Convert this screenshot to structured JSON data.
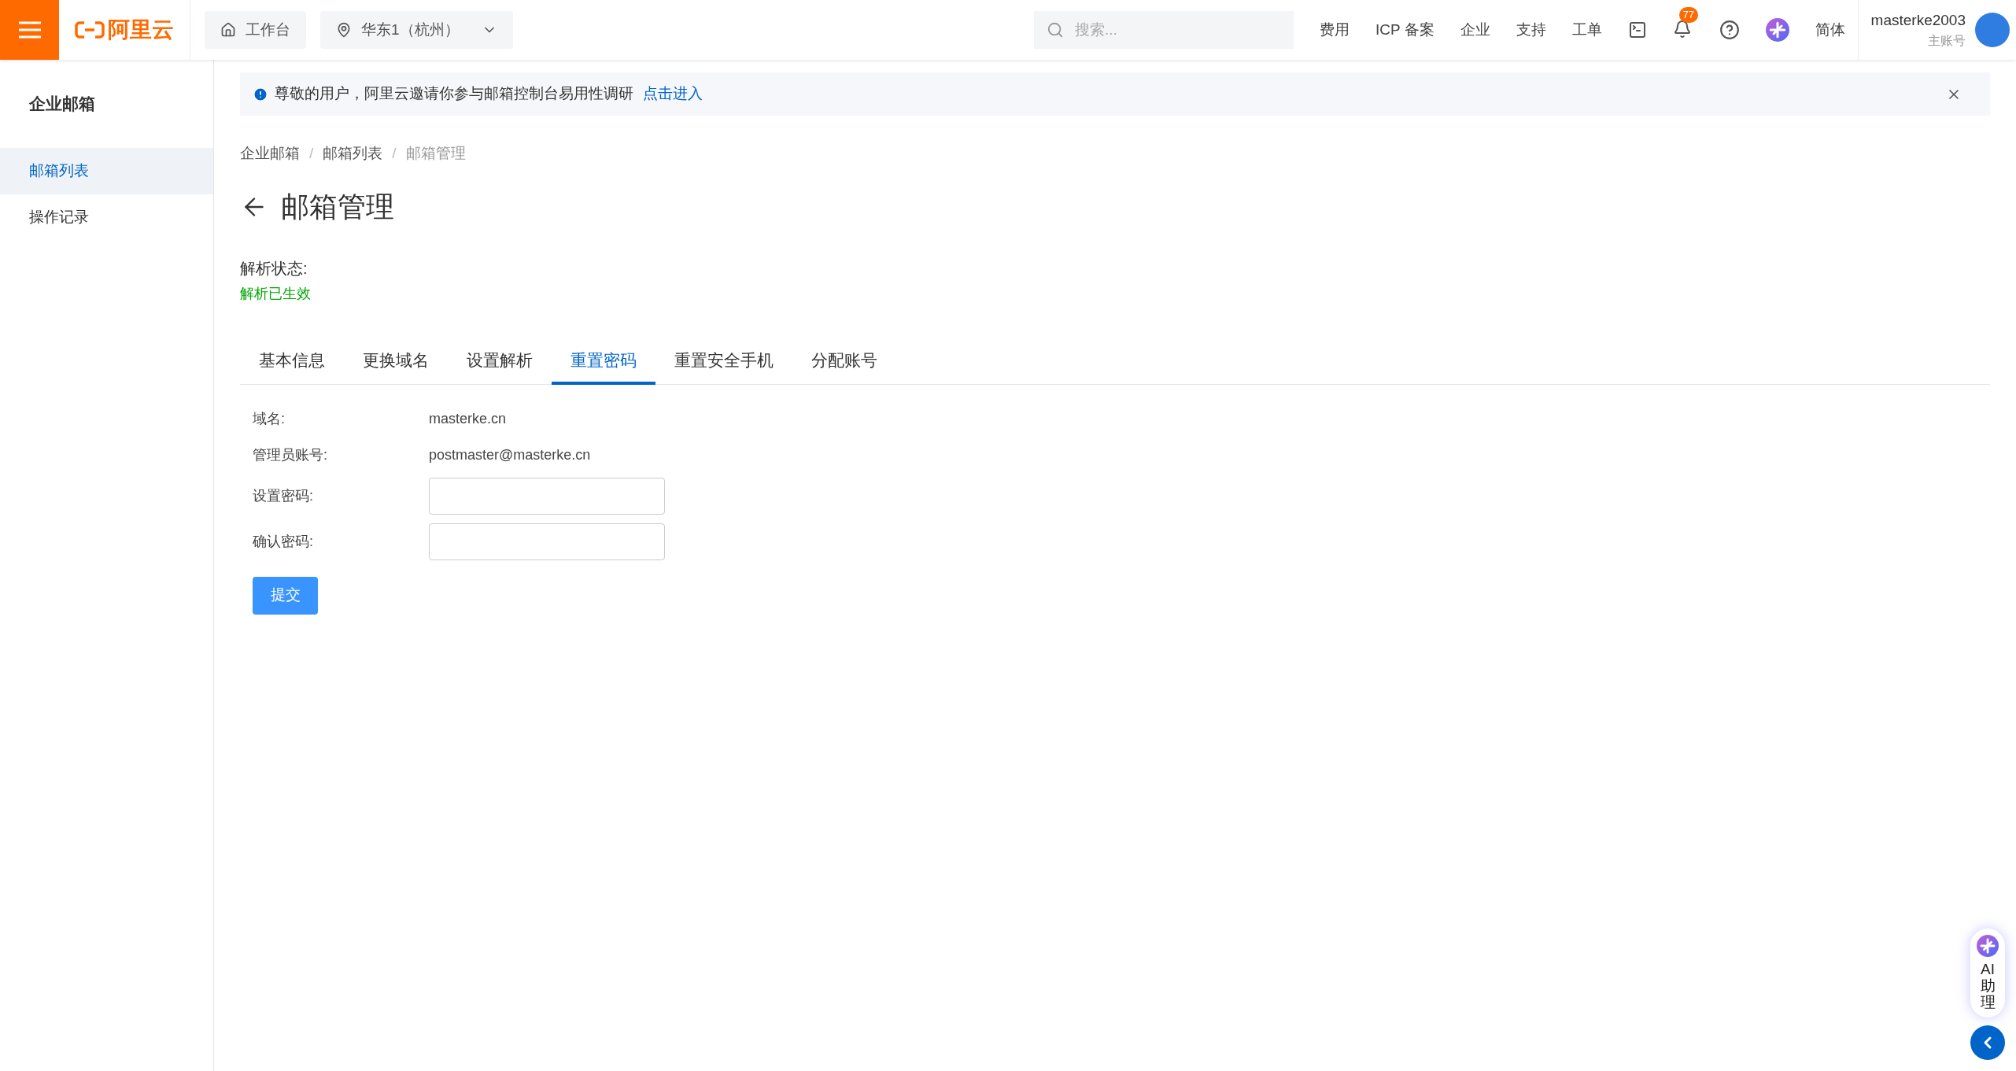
{
  "topbar": {
    "logo": "阿里云",
    "workbench": "工作台",
    "region": "华东1（杭州）",
    "search": {
      "placeholder": "搜索..."
    },
    "links": [
      "费用",
      "ICP 备案",
      "企业",
      "支持",
      "工单"
    ],
    "notification_count": "77",
    "language": "简体",
    "user": {
      "name": "masterke2003",
      "role": "主账号"
    }
  },
  "sidebar": {
    "title": "企业邮箱",
    "items": [
      {
        "label": "邮箱列表",
        "selected": true
      },
      {
        "label": "操作记录",
        "selected": false
      }
    ]
  },
  "banner": {
    "text": "尊敬的用户，阿里云邀请你参与邮箱控制台易用性调研",
    "link": "点击进入"
  },
  "breadcrumb": [
    "企业邮箱",
    "邮箱列表",
    "邮箱管理"
  ],
  "breadcrumb_separator": "/",
  "page_title": "邮箱管理",
  "status": {
    "label": "解析状态:",
    "value": "解析已生效"
  },
  "tabs": [
    {
      "label": "基本信息",
      "selected": false
    },
    {
      "label": "更换域名",
      "selected": false
    },
    {
      "label": "设置解析",
      "selected": false
    },
    {
      "label": "重置密码",
      "selected": true
    },
    {
      "label": "重置安全手机",
      "selected": false
    },
    {
      "label": "分配账号",
      "selected": false
    }
  ],
  "form": {
    "rows": [
      {
        "kind": "text",
        "label": "域名:",
        "value": "masterke.cn"
      },
      {
        "kind": "text",
        "label": "管理员账号:",
        "value": "postmaster@masterke.cn"
      },
      {
        "kind": "input",
        "label": "设置密码:"
      },
      {
        "kind": "input",
        "label": "确认密码:"
      }
    ],
    "submit": "提交"
  },
  "ai_assistant": {
    "label": "AI助理"
  }
}
